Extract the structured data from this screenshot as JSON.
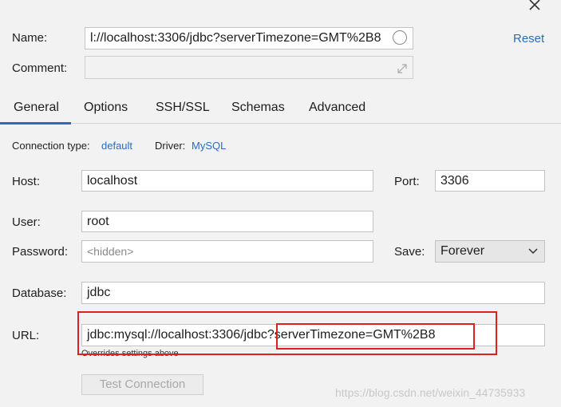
{
  "dialog": {
    "close_icon": "close-icon"
  },
  "name": {
    "label": "Name:",
    "value": "l://localhost:3306/jdbc?serverTimezone=GMT%2B8",
    "reset": "Reset"
  },
  "comment": {
    "label": "Comment:",
    "value": ""
  },
  "tabs": [
    {
      "label": "General",
      "active": true
    },
    {
      "label": "Options"
    },
    {
      "label": "SSH/SSL"
    },
    {
      "label": "Schemas"
    },
    {
      "label": "Advanced"
    }
  ],
  "conn": {
    "type_label": "Connection type:",
    "type_value": "default",
    "driver_label": "Driver:",
    "driver_value": "MySQL"
  },
  "host": {
    "label": "Host:",
    "value": "localhost"
  },
  "port": {
    "label": "Port:",
    "value": "3306"
  },
  "user": {
    "label": "User:",
    "value": "root"
  },
  "password": {
    "label": "Password:",
    "placeholder": "<hidden>"
  },
  "save": {
    "label": "Save:",
    "value": "Forever"
  },
  "database": {
    "label": "Database:",
    "value": "jdbc"
  },
  "url": {
    "label": "URL:",
    "value_prefix": "jdbc:mysql://localhost:3306/jdbc",
    "value_suffix": "?serverTimezone=GMT%2B8",
    "hint": "Overrides settings above"
  },
  "test_button": "Test Connection",
  "watermark": "https://blog.csdn.net/weixin_44735933",
  "colors": {
    "accent": "#2a6ebb",
    "highlight": "#e02020"
  }
}
